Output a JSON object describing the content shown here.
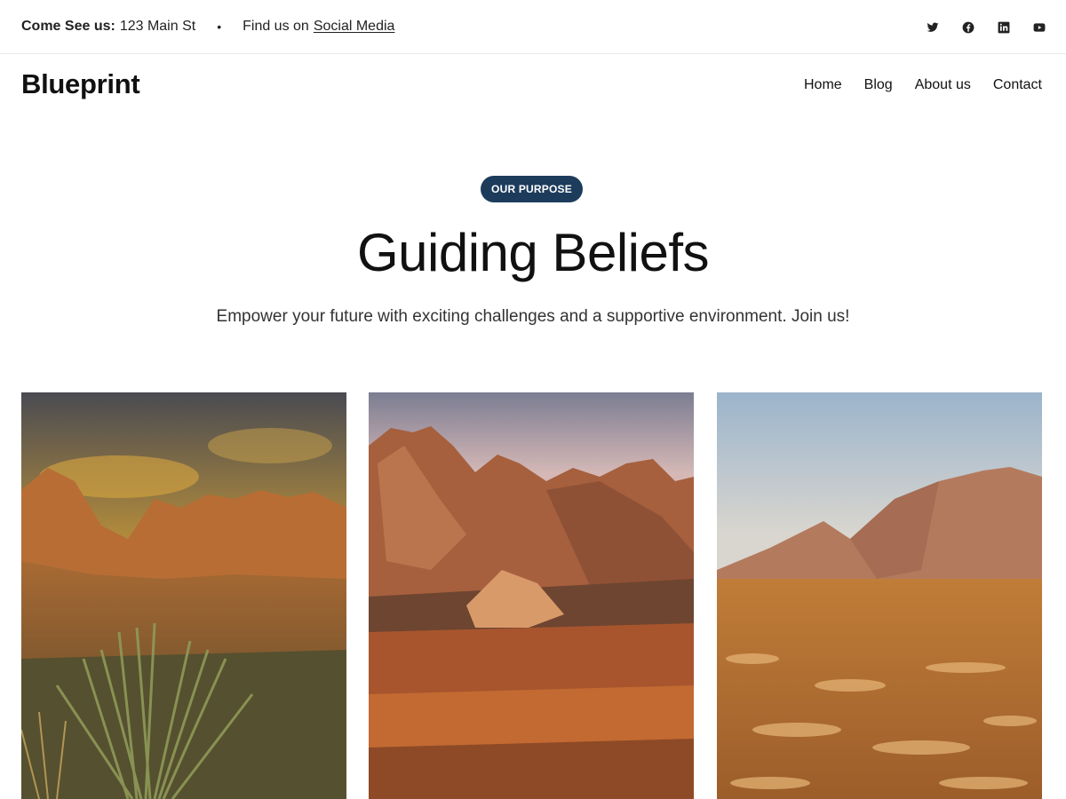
{
  "topbar": {
    "visit_label": "Come See us:",
    "address": "123 Main St",
    "separator": "•",
    "social_prefix": "Find us on",
    "social_link": "Social Media",
    "icons": [
      "twitter-icon",
      "facebook-icon",
      "linkedin-icon",
      "youtube-icon"
    ]
  },
  "header": {
    "site_title": "Blueprint",
    "nav": [
      "Home",
      "Blog",
      "About us",
      "Contact"
    ]
  },
  "hero": {
    "badge": "OUR PURPOSE",
    "title": "Guiding Beliefs",
    "subtitle": "Empower your future with exciting challenges and a supportive environment. Join us!"
  },
  "gallery": {
    "images": [
      "desert-mountains-sunset-photo",
      "rocky-peaks-photo",
      "desert-plain-mountain-photo"
    ]
  },
  "colors": {
    "badge_bg": "#1d3c5c",
    "text": "#111111"
  }
}
